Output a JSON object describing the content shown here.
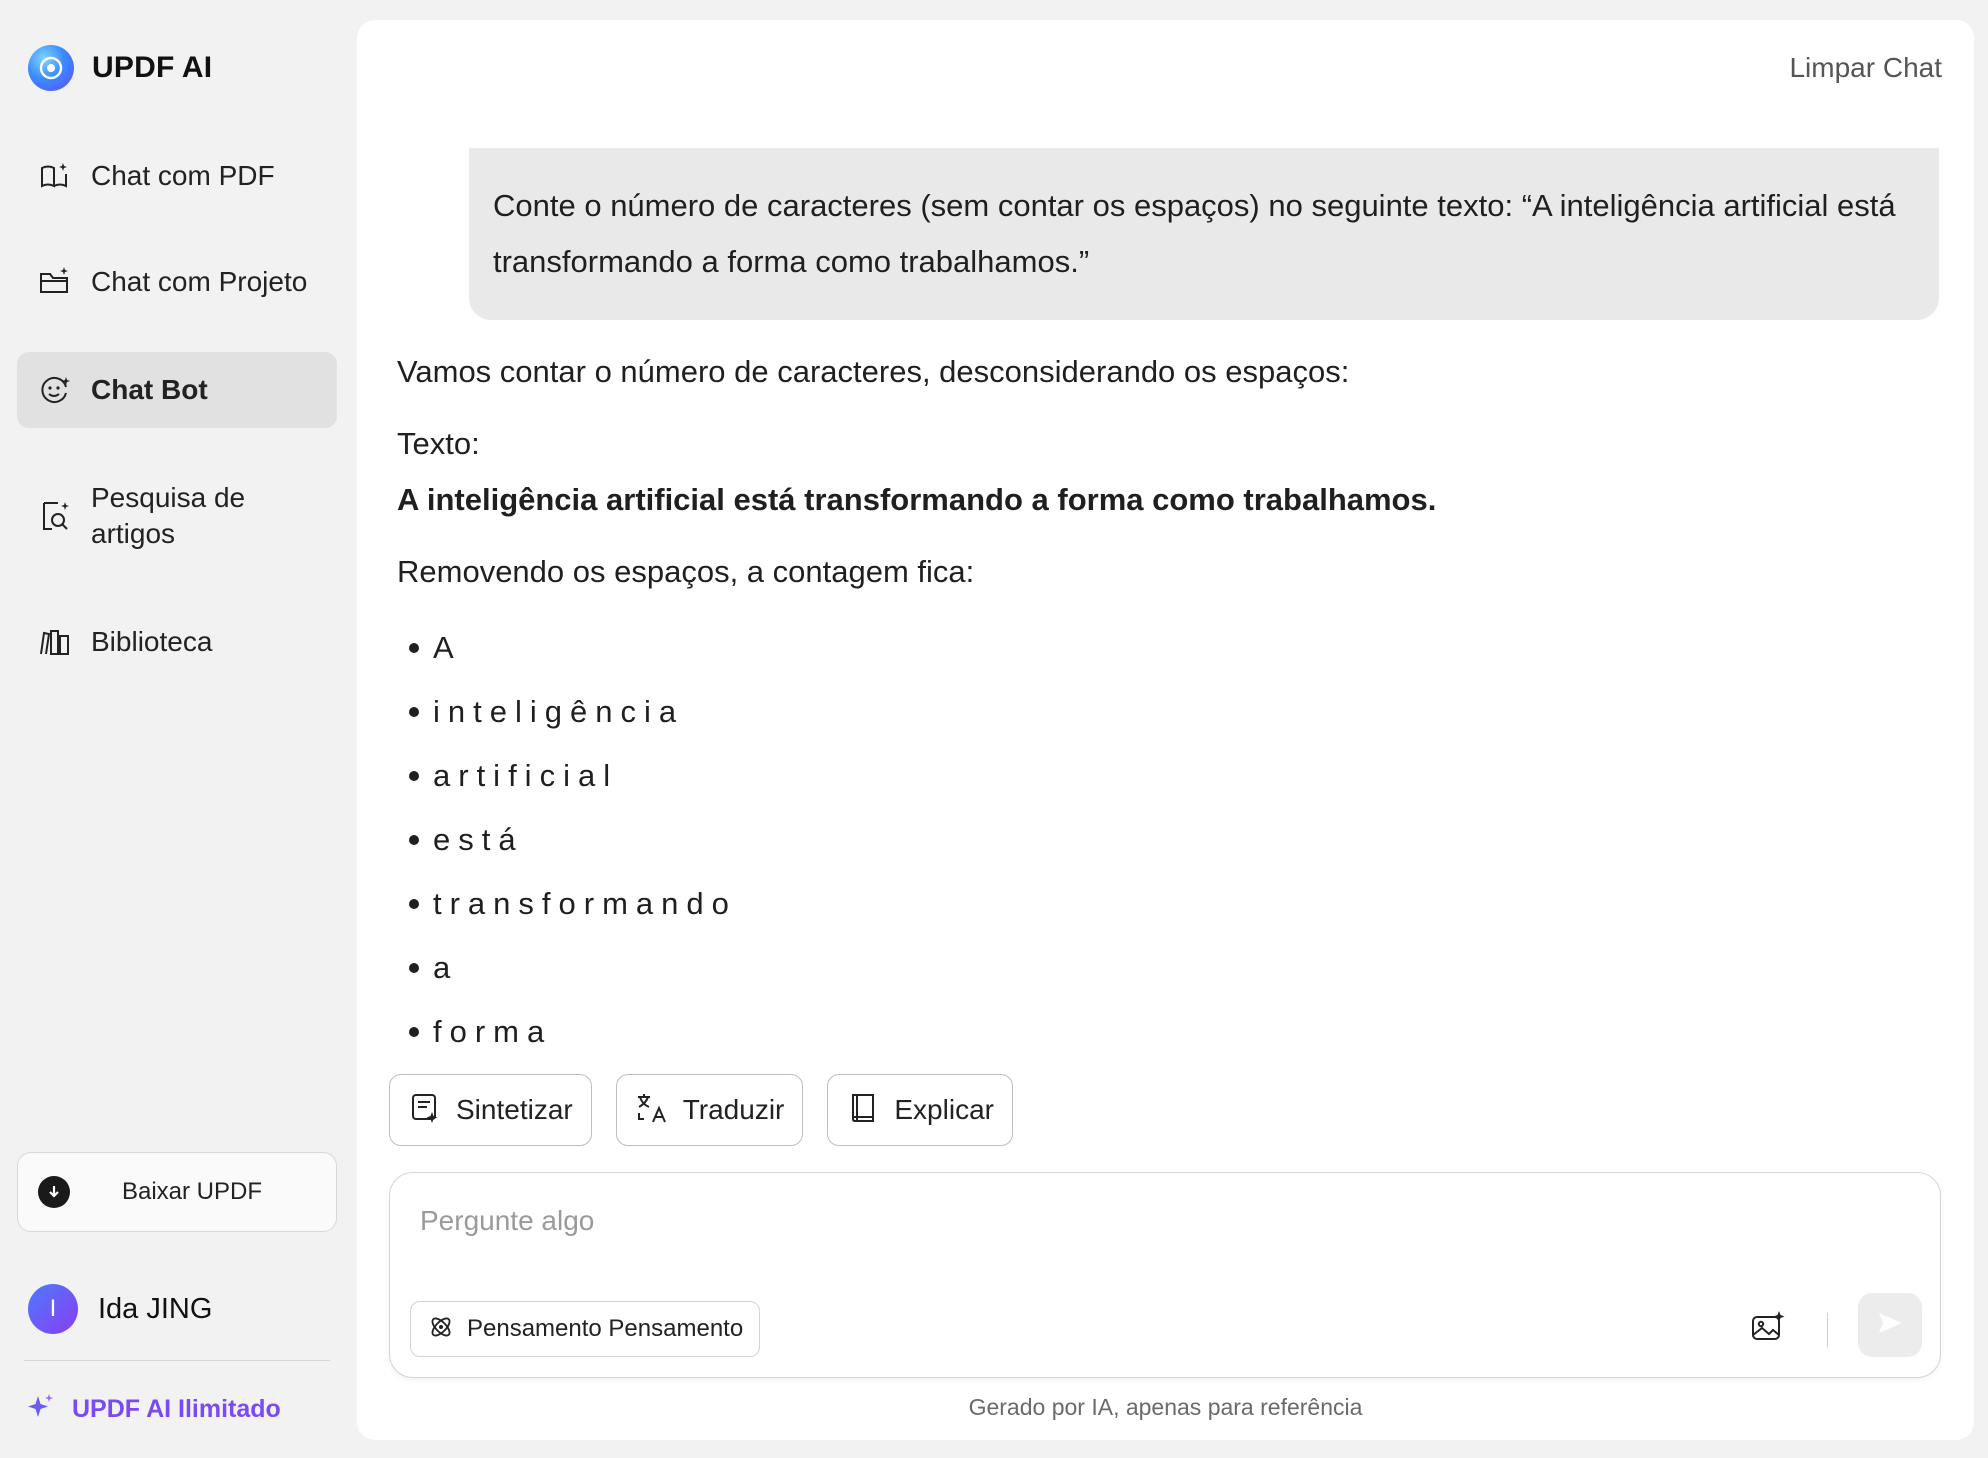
{
  "brand": {
    "name": "UPDF AI"
  },
  "sidebar": {
    "items": [
      {
        "label": "Chat com PDF",
        "icon": "book-sparkle-icon"
      },
      {
        "label": "Chat com Projeto",
        "icon": "folder-sparkle-icon"
      },
      {
        "label": "Chat Bot",
        "icon": "bot-face-icon",
        "active": true
      },
      {
        "label": "Pesquisa de artigos",
        "icon": "document-search-icon"
      },
      {
        "label": "Biblioteca",
        "icon": "library-icon"
      }
    ],
    "download_label": "Baixar UPDF",
    "user": {
      "initial": "I",
      "name": "Ida JING"
    },
    "upgrade_label": "UPDF AI Ilimitado"
  },
  "header": {
    "clear_chat": "Limpar Chat"
  },
  "conversation": {
    "user_message": "Conte o número de caracteres (sem contar os espaços) no seguinte texto: “A inteligência artificial está transformando a forma como trabalhamos.”",
    "answer": {
      "intro": "Vamos contar o número de caracteres, desconsiderando os espaços:",
      "text_label": "Texto:",
      "text_value": "A inteligência artificial está transformando a forma como trabalhamos.",
      "removing_line": "Removendo os espaços, a contagem fica:",
      "list": [
        "A",
        "inteligência",
        "artificial",
        "está",
        "transformando",
        "a",
        "forma"
      ]
    }
  },
  "actions": [
    {
      "label": "Sintetizar",
      "icon": "summarize-icon"
    },
    {
      "label": "Traduzir",
      "icon": "translate-icon"
    },
    {
      "label": "Explicar",
      "icon": "book-icon"
    }
  ],
  "composer": {
    "placeholder": "Pergunte algo",
    "thinking_label": "Pensamento Pensamento"
  },
  "footer_note": "Gerado por IA, apenas para referência",
  "colors": {
    "accent": "#7a4bf0",
    "active_item_bg": "#e1e1e1",
    "bubble_bg": "#e9e9e9"
  }
}
